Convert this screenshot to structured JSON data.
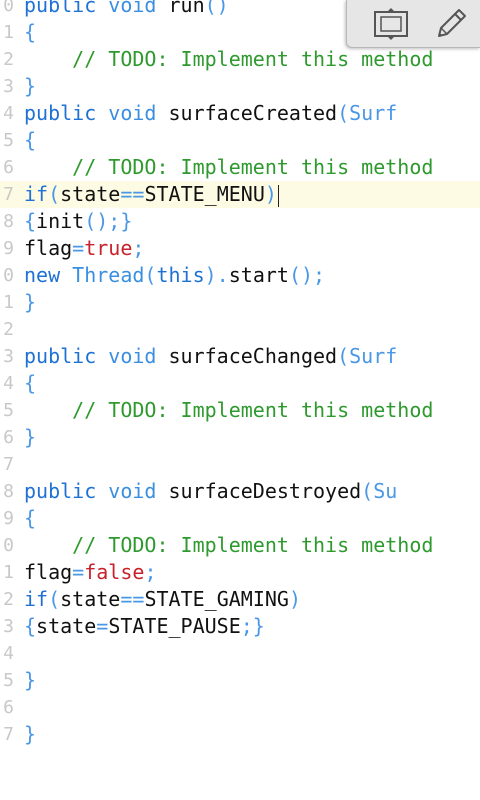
{
  "editor": {
    "current_line": 7,
    "lines": [
      {
        "n": "0",
        "t": [
          [
            "public",
            "kw"
          ],
          [
            " "
          ],
          [
            "void",
            "ty"
          ],
          [
            " run"
          ],
          [
            "()",
            "pn"
          ]
        ]
      },
      {
        "n": "1",
        "t": [
          [
            "{",
            "pn"
          ]
        ]
      },
      {
        "n": "2",
        "t": [
          [
            "    // TODO: Implement this method",
            "cm"
          ]
        ]
      },
      {
        "n": "3",
        "t": [
          [
            "}",
            "pn"
          ]
        ]
      },
      {
        "n": "4",
        "t": [
          [
            "public",
            "kw"
          ],
          [
            " "
          ],
          [
            "void",
            "ty"
          ],
          [
            " surfaceCreated"
          ],
          [
            "(Surf",
            "pn"
          ]
        ]
      },
      {
        "n": "5",
        "t": [
          [
            "{",
            "pn"
          ]
        ]
      },
      {
        "n": "6",
        "t": [
          [
            "    // TODO: Implement this method",
            "cm"
          ]
        ]
      },
      {
        "n": "7",
        "t": [
          [
            "if",
            "kw"
          ],
          [
            "(",
            "pn"
          ],
          [
            "state"
          ],
          [
            "==",
            "pn"
          ],
          [
            "STATE_MENU"
          ],
          [
            ")",
            "pn"
          ]
        ],
        "caret": true
      },
      {
        "n": "8",
        "t": [
          [
            "{",
            "pn"
          ],
          [
            "init"
          ],
          [
            "();}",
            "pn"
          ]
        ]
      },
      {
        "n": "9",
        "t": [
          [
            "flag"
          ],
          [
            "=",
            "pn"
          ],
          [
            "true",
            "lit"
          ],
          [
            ";",
            "pn"
          ]
        ]
      },
      {
        "n": "0",
        "t": [
          [
            "new",
            "kw"
          ],
          [
            " "
          ],
          [
            "Thread",
            "ty"
          ],
          [
            "(",
            "pn"
          ],
          [
            "this",
            "kw"
          ],
          [
            ").",
            "pn"
          ],
          [
            "start"
          ],
          [
            "();",
            "pn"
          ]
        ]
      },
      {
        "n": "1",
        "t": [
          [
            "}",
            "pn"
          ]
        ]
      },
      {
        "n": "2",
        "t": []
      },
      {
        "n": "3",
        "t": [
          [
            "public",
            "kw"
          ],
          [
            " "
          ],
          [
            "void",
            "ty"
          ],
          [
            " surfaceChanged"
          ],
          [
            "(Surf",
            "pn"
          ]
        ]
      },
      {
        "n": "4",
        "t": [
          [
            "{",
            "pn"
          ]
        ]
      },
      {
        "n": "5",
        "t": [
          [
            "    // TODO: Implement this method",
            "cm"
          ]
        ]
      },
      {
        "n": "6",
        "t": [
          [
            "}",
            "pn"
          ]
        ]
      },
      {
        "n": "7",
        "t": []
      },
      {
        "n": "8",
        "t": [
          [
            "public",
            "kw"
          ],
          [
            " "
          ],
          [
            "void",
            "ty"
          ],
          [
            " surfaceDestroyed"
          ],
          [
            "(Su",
            "pn"
          ]
        ]
      },
      {
        "n": "9",
        "t": [
          [
            "{",
            "pn"
          ]
        ]
      },
      {
        "n": "0",
        "t": [
          [
            "    // TODO: Implement this method",
            "cm"
          ]
        ]
      },
      {
        "n": "1",
        "t": [
          [
            "flag"
          ],
          [
            "=",
            "pn"
          ],
          [
            "false",
            "lit"
          ],
          [
            ";",
            "pn"
          ]
        ]
      },
      {
        "n": "2",
        "t": [
          [
            "if",
            "kw"
          ],
          [
            "(",
            "pn"
          ],
          [
            "state"
          ],
          [
            "==",
            "pn"
          ],
          [
            "STATE_GAMING"
          ],
          [
            ")",
            "pn"
          ]
        ]
      },
      {
        "n": "3",
        "t": [
          [
            "{",
            "pn"
          ],
          [
            "state"
          ],
          [
            "=",
            "pn"
          ],
          [
            "STATE_PAUSE"
          ],
          [
            ";}",
            "pn"
          ]
        ]
      },
      {
        "n": "4",
        "t": []
      },
      {
        "n": "5",
        "t": [
          [
            "}",
            "pn"
          ]
        ]
      },
      {
        "n": "6",
        "t": []
      },
      {
        "n": "7",
        "t": [
          [
            "}",
            "pn"
          ]
        ]
      }
    ]
  },
  "toolbar": {
    "buttons": [
      {
        "id": "fullscreen",
        "icon": "fullscreen-toggle-icon"
      },
      {
        "id": "edit",
        "icon": "pencil-icon"
      }
    ]
  },
  "colors": {
    "keyword": "#1f72d4",
    "type": "#3a8fe0",
    "punctuation": "#4a97e6",
    "comment": "#2e9a2e",
    "literal": "#c8222c",
    "current_line_bg": "#fdfbe3"
  }
}
